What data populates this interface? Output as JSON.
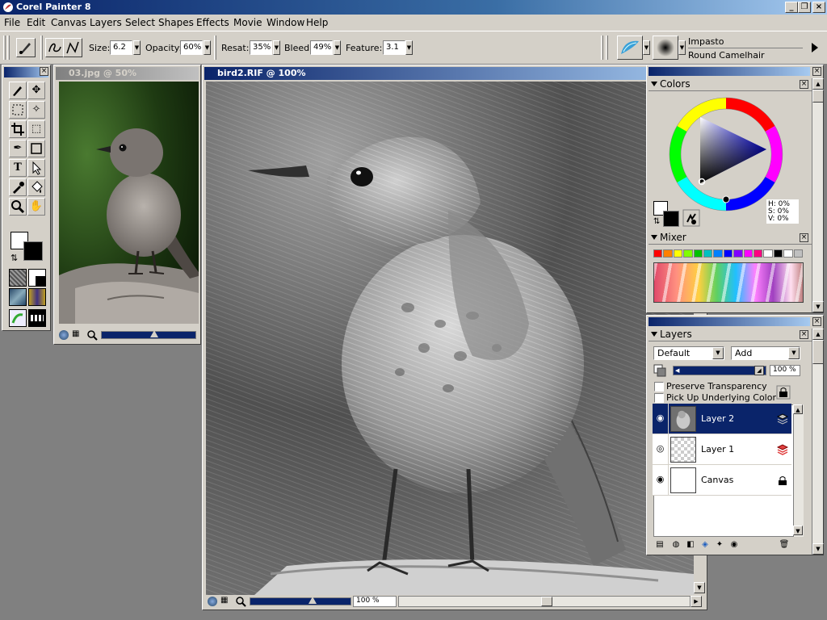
{
  "app": {
    "title": "Corel Painter 8"
  },
  "window_controls": {
    "minimize": "_",
    "maximize": "❐",
    "close": "×"
  },
  "menu": [
    "File",
    "Edit",
    "Canvas",
    "Layers",
    "Select",
    "Shapes",
    "Effects",
    "Movie",
    "Window",
    "Help"
  ],
  "property_bar": {
    "size_label": "Size:",
    "size_value": "6.2",
    "opacity_label": "Opacity:",
    "opacity_value": "60%",
    "resat_label": "Resat:",
    "resat_value": "35%",
    "bleed_label": "Bleed:",
    "bleed_value": "49%",
    "feature_label": "Feature:",
    "feature_value": "3.1",
    "brush_category": "Impasto",
    "brush_variant": "Round Camelhair"
  },
  "source_window": {
    "title": "03.jpg @ 50%"
  },
  "canvas_window": {
    "title": "bird2.RIF @ 100%",
    "zoom": "100 %"
  },
  "colors_palette": {
    "title": "Colors",
    "hsv": {
      "h": "H: 0%",
      "s": "S: 0%",
      "v": "V: 0%"
    }
  },
  "mixer_palette": {
    "title": "Mixer",
    "swatches": [
      "#ff0000",
      "#ff8000",
      "#ffff00",
      "#80ff00",
      "#00c000",
      "#00c0c0",
      "#0080ff",
      "#0000ff",
      "#8000ff",
      "#ff00ff",
      "#ff0080",
      "#ffffff",
      "#000000",
      "#ffffff",
      "#c0c0c0"
    ]
  },
  "layers_palette": {
    "title": "Layers",
    "composite_method": "Default",
    "composite_depth": "Add",
    "opacity": "100 %",
    "preserve_transparency": "Preserve Transparency",
    "pick_up_underlying": "Pick Up Underlying Color",
    "layers": [
      {
        "name": "Layer 2",
        "selected": true
      },
      {
        "name": "Layer 1",
        "selected": false
      },
      {
        "name": "Canvas",
        "selected": false
      }
    ]
  },
  "colors": {
    "accent": "#0a246a",
    "chrome": "#d4d0c8",
    "workspace": "#808080"
  }
}
